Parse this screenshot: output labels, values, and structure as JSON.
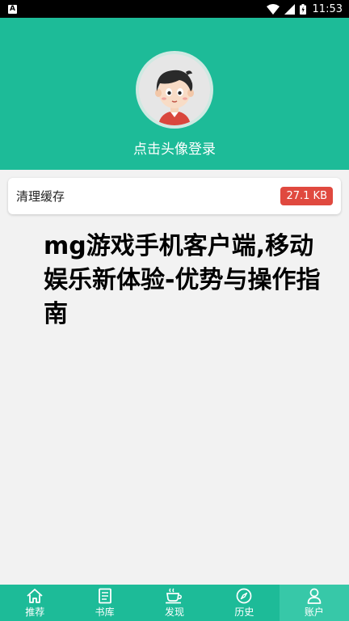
{
  "status_bar": {
    "notification_badge": "A",
    "time": "11:53"
  },
  "header": {
    "login_label": "点击头像登录"
  },
  "cache": {
    "label": "清理缓存",
    "size": "27.1 KB"
  },
  "article": {
    "title": "mg游戏手机客户端,移动娱乐新体验-优势与操作指南"
  },
  "tabs": [
    {
      "label": "推荐",
      "icon": "home-icon",
      "active": false
    },
    {
      "label": "书库",
      "icon": "book-icon",
      "active": false
    },
    {
      "label": "发现",
      "icon": "cup-icon",
      "active": false
    },
    {
      "label": "历史",
      "icon": "compass-icon",
      "active": false
    },
    {
      "label": "账户",
      "icon": "person-icon",
      "active": true
    }
  ],
  "colors": {
    "brand_green": "#1dbb98",
    "active_tab": "#37c8a8",
    "badge_red": "#e0493f"
  }
}
